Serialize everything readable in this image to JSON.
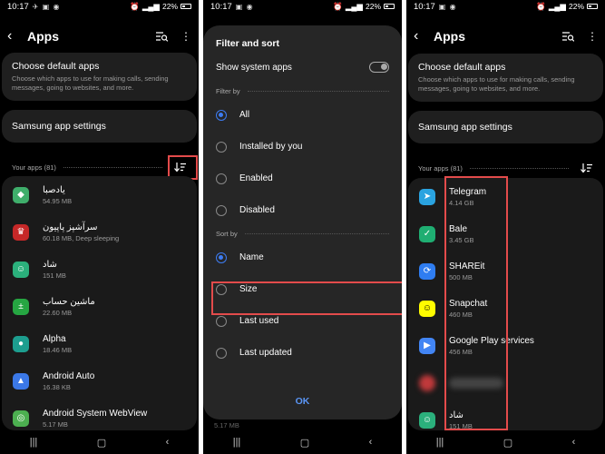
{
  "status": {
    "time": "10:17",
    "battery": "22%"
  },
  "appbar": {
    "title": "Apps"
  },
  "default_apps": {
    "title": "Choose default apps",
    "subtitle": "Choose which apps to use for making calls, sending messages, going to websites, and more."
  },
  "samsung_settings": {
    "title": "Samsung app settings"
  },
  "your_apps_label": "Your apps (81)",
  "list1": [
    {
      "name": "یادصبا",
      "size": "54.95 MB",
      "icon_color": "#3fae6b"
    },
    {
      "name": "سرآشپز پاپیون",
      "size": "60.18 MB, Deep sleeping",
      "icon_color": "#c62828"
    },
    {
      "name": "شاد",
      "size": "151 MB",
      "icon_color": "#2bb07c"
    },
    {
      "name": "ماشین حساب",
      "size": "22.60 MB",
      "icon_color": "#26a642"
    },
    {
      "name": "Alpha",
      "size": "18.46 MB",
      "icon_color": "#1d9e8f"
    },
    {
      "name": "Android Auto",
      "size": "16.38 KB",
      "icon_color": "#3b78e7"
    },
    {
      "name": "Android System WebView",
      "size": "5.17 MB",
      "icon_color": "#4caf50"
    }
  ],
  "dialog": {
    "title": "Filter and sort",
    "show_system": "Show system apps",
    "filter_by": "Filter by",
    "filters": [
      "All",
      "Installed by you",
      "Enabled",
      "Disabled"
    ],
    "sort_by": "Sort by",
    "sorts": [
      "Name",
      "Size",
      "Last used",
      "Last updated"
    ],
    "ok": "OK",
    "peek_size": "5.17 MB"
  },
  "list3": [
    {
      "name": "Telegram",
      "size": "4.14 GB",
      "icon_color": "#2aa3e0"
    },
    {
      "name": "Bale",
      "size": "3.45 GB",
      "icon_color": "#1fae72"
    },
    {
      "name": "SHAREit",
      "size": "500 MB",
      "icon_color": "#2f7df1"
    },
    {
      "name": "Snapchat",
      "size": "460 MB",
      "icon_color": "#fffc00"
    },
    {
      "name": "Google Play services",
      "size": "456 MB",
      "icon_color": "#4285f4"
    },
    {
      "name": "",
      "size": "",
      "icon_color": "#c0393b"
    },
    {
      "name": "شاد",
      "size": "151 MB",
      "icon_color": "#2bb07c"
    }
  ]
}
